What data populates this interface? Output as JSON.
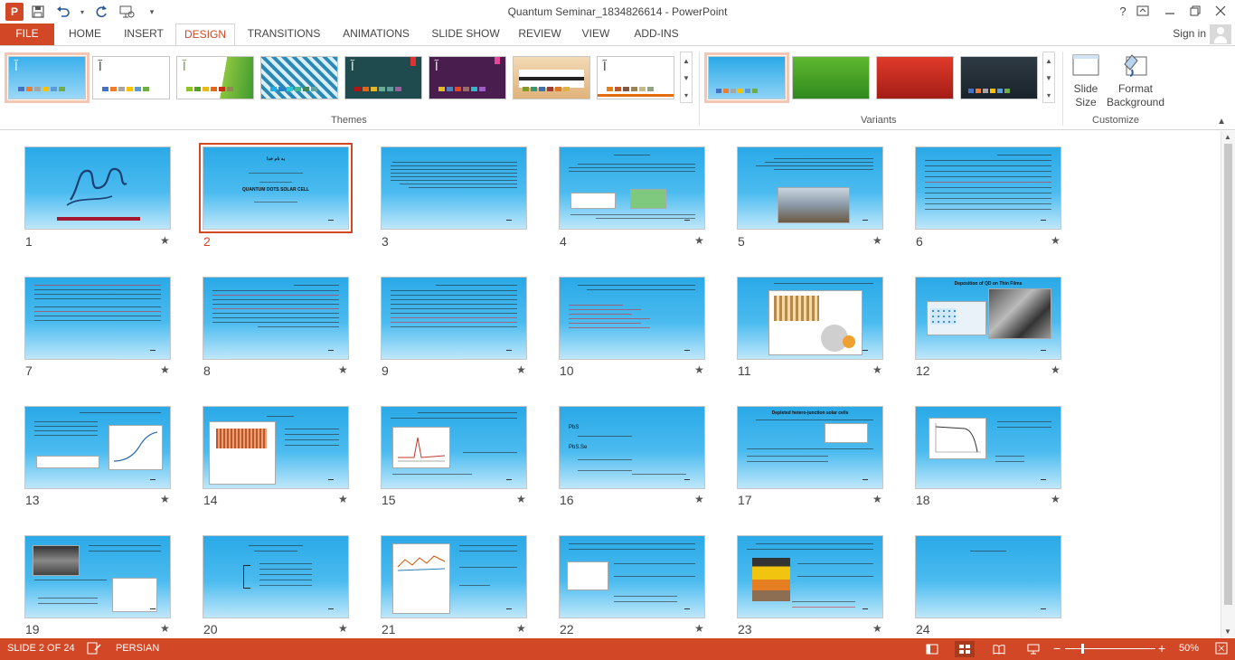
{
  "window": {
    "title": "Quantum Seminar_1834826614 - PowerPoint"
  },
  "qat": {
    "app_icon": "P",
    "save_icon": "save-icon",
    "undo_icon": "undo-icon",
    "redo_icon": "redo-icon",
    "customize_icon": "customize-qat-icon"
  },
  "window_controls": {
    "help": "?",
    "ribbon_options": "ribbon-display-options-icon",
    "minimize": "minimize-icon",
    "restore": "restore-icon",
    "close": "close-icon"
  },
  "tabs": [
    {
      "label": "FILE"
    },
    {
      "label": "HOME"
    },
    {
      "label": "INSERT"
    },
    {
      "label": "DESIGN"
    },
    {
      "label": "TRANSITIONS"
    },
    {
      "label": "ANIMATIONS"
    },
    {
      "label": "SLIDE SHOW"
    },
    {
      "label": "REVIEW"
    },
    {
      "label": "VIEW"
    },
    {
      "label": "ADD-INS"
    }
  ],
  "account": {
    "sign_in": "Sign in"
  },
  "ribbon": {
    "themes_label": "Themes",
    "variants_label": "Variants",
    "customize_label": "Customize",
    "theme_glyph": "آ",
    "slide_size": "Slide Size",
    "format_background": "Format Background"
  },
  "slides": [
    {
      "number": "1"
    },
    {
      "number": "2"
    },
    {
      "number": "3"
    },
    {
      "number": "4"
    },
    {
      "number": "5"
    },
    {
      "number": "6"
    },
    {
      "number": "7"
    },
    {
      "number": "8"
    },
    {
      "number": "9"
    },
    {
      "number": "10"
    },
    {
      "number": "11"
    },
    {
      "number": "12"
    },
    {
      "number": "13"
    },
    {
      "number": "14"
    },
    {
      "number": "15"
    },
    {
      "number": "16"
    },
    {
      "number": "17"
    },
    {
      "number": "18"
    },
    {
      "number": "19"
    },
    {
      "number": "20"
    },
    {
      "number": "21"
    },
    {
      "number": "22"
    },
    {
      "number": "23"
    },
    {
      "number": "24"
    }
  ],
  "slide_text": {
    "s2_line1": "به نام خدا",
    "s2_line2": "QUANTUM DOTS SOLAR CELL",
    "s12_title": "Deposition of QD on Thin Films",
    "s17_title": "Depleted hetero-junction solar cells",
    "s16_item1": "PbS",
    "s16_item2": "PbS.Se"
  },
  "status": {
    "slide_indicator": "SLIDE 2 OF 24",
    "language": "PERSIAN",
    "zoom": "50%"
  },
  "colors": {
    "accent": "#d24726",
    "slide_background": "#2aa9e7"
  }
}
